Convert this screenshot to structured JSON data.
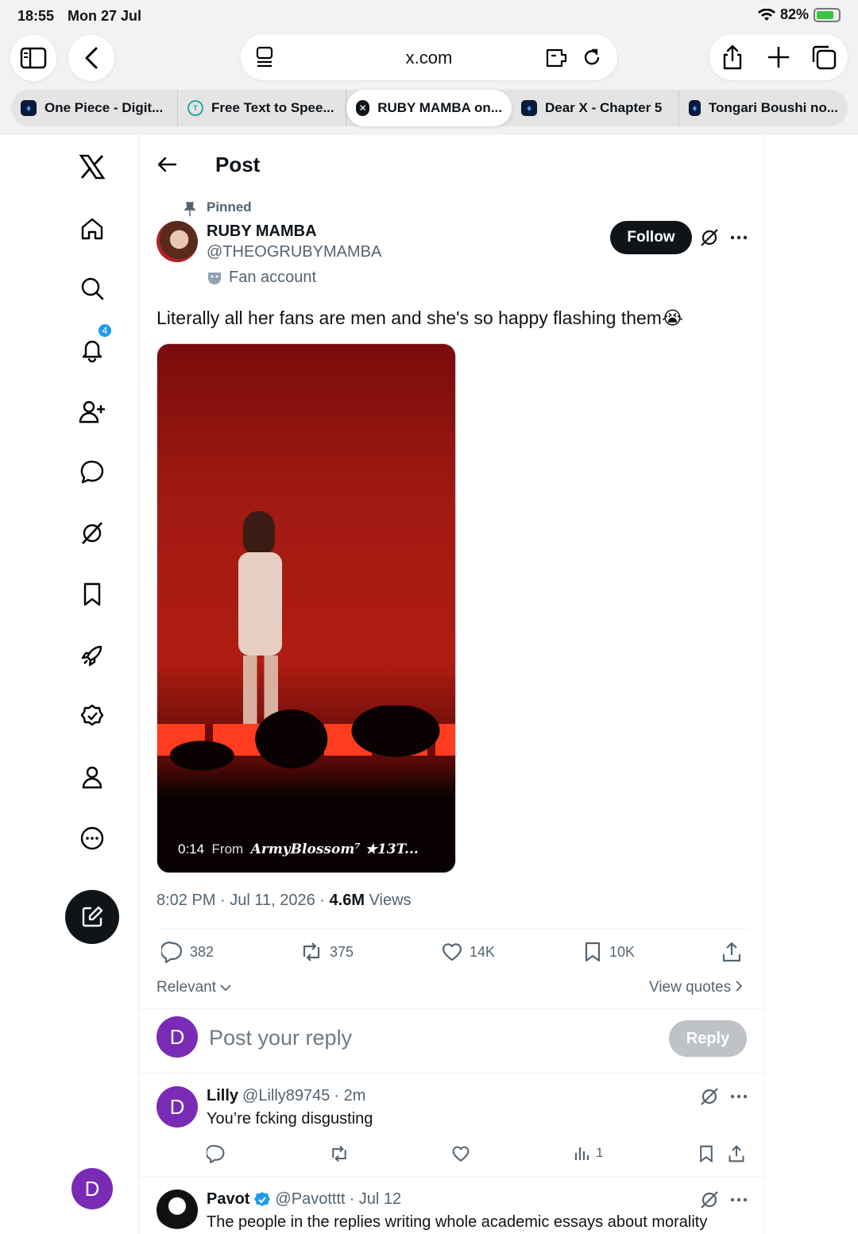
{
  "status": {
    "time": "18:55",
    "date": "Mon 27 Jul",
    "battery": "82%",
    "battery_level": 0.82
  },
  "browser": {
    "url": "x.com",
    "tabs": [
      {
        "label": "One Piece - Digit..."
      },
      {
        "label": "Free Text to Spee..."
      },
      {
        "label": "RUBY MAMBA on..."
      },
      {
        "label": "Dear X - Chapter 5"
      },
      {
        "label": "Tongari Boushi no..."
      }
    ]
  },
  "sidebar": {
    "notif_count": "4",
    "avatar_letter": "D"
  },
  "header": {
    "title": "Post"
  },
  "post": {
    "pinned": "Pinned",
    "name": "RUBY MAMBA",
    "handle": "@THEOGRUBYMAMBA",
    "label": "Fan account",
    "follow": "Follow",
    "text": "Literally all her fans are men and she's so happy flashing them😭",
    "video_time": "0:14",
    "video_from": "From",
    "video_source": "ArmyBlossom⁷ ★13T...",
    "time": "8:02 PM · Jul 11, 2026 · ",
    "views_count": "4.6M",
    "views_label": " Views",
    "replies": "382",
    "reposts": "375",
    "likes": "14K",
    "bookmarks": "10K"
  },
  "sort": {
    "label": "Relevant",
    "view_quotes": "View quotes"
  },
  "reply_box": {
    "avatar": "D",
    "placeholder": "Post your reply",
    "button": "Reply"
  },
  "comments": [
    {
      "avatar": "D",
      "name": "Lilly",
      "handle": "@Lilly89745",
      "time": " · 2m",
      "text": "You’re fcking disgusting",
      "views": "1"
    },
    {
      "name": "Pavot",
      "handle": "@Pavotttt",
      "time": " · Jul 12",
      "text": "The people in the replies writing whole academic essays about morality"
    }
  ]
}
